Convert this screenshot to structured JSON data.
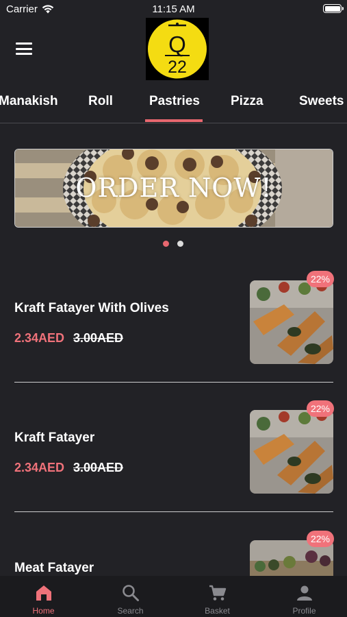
{
  "status_bar": {
    "carrier": "Carrier",
    "time": "11:15 AM"
  },
  "logo": {
    "letter": "Q",
    "number": "22",
    "color": "#f4dc12"
  },
  "categories": [
    "Manakish",
    "Roll",
    "Pastries",
    "Pizza",
    "Sweets"
  ],
  "active_category": "Pastries",
  "banner": {
    "text": "ORDER NOW!",
    "slides": 2,
    "active_slide": 1
  },
  "products": [
    {
      "name": "Kraft Fatayer With Olives",
      "price": "2.34AED",
      "old_price": "3.00AED",
      "discount": "22%"
    },
    {
      "name": "Kraft Fatayer",
      "price": "2.34AED",
      "old_price": "3.00AED",
      "discount": "22%"
    },
    {
      "name": "Meat Fatayer",
      "price": "",
      "old_price": "",
      "discount": "22%"
    }
  ],
  "tabbar": {
    "items": [
      {
        "label": "Home",
        "icon": "home-icon"
      },
      {
        "label": "Search",
        "icon": "search-icon"
      },
      {
        "label": "Basket",
        "icon": "cart-icon"
      },
      {
        "label": "Profile",
        "icon": "person-icon"
      }
    ],
    "active": "Home"
  },
  "colors": {
    "accent": "#f0727a",
    "background": "#222226",
    "tabbar": "#1b1b1e"
  }
}
